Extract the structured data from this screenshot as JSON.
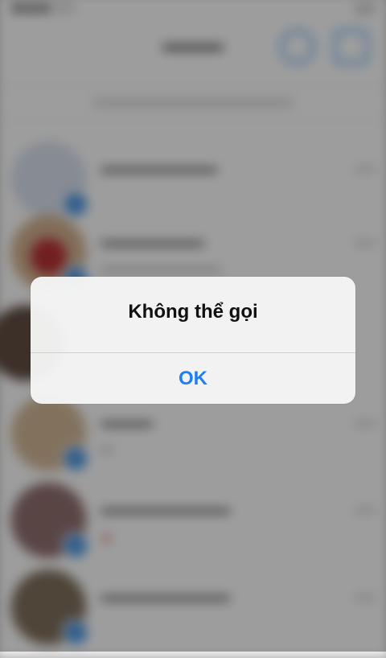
{
  "alert": {
    "title": "Không thể gọi",
    "ok_label": "OK"
  },
  "colors": {
    "accent": "#1f7ff0",
    "overlay": "rgba(0,0,0,0.35)"
  }
}
